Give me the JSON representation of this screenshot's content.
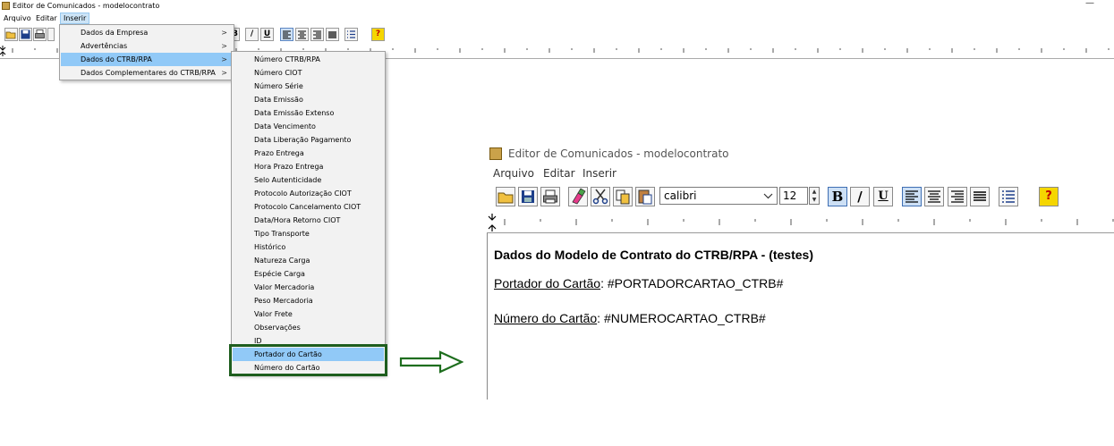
{
  "small_window": {
    "title": "Editor de Comunicados - modelocontrato",
    "minimize_glyph": "—",
    "menus": [
      "Arquivo",
      "Editar",
      "Inserir"
    ],
    "toolbar_visible_glyphs": {
      "bold": "B",
      "italic": "/",
      "underline": "U",
      "help": "?"
    }
  },
  "inserir_menu": {
    "items": [
      {
        "label": "Dados da Empresa",
        "has_submenu": true
      },
      {
        "label": "Advertências",
        "has_submenu": true
      },
      {
        "label": "Dados do CTRB/RPA",
        "has_submenu": true,
        "highlighted": true
      },
      {
        "label": "Dados Complementares do CTRB/RPA",
        "has_submenu": true
      }
    ],
    "submenu_arrow": ">"
  },
  "ctrb_submenu": {
    "items": [
      "Número CTRB/RPA",
      "Número CIOT",
      "Número Série",
      "Data Emissão",
      "Data Emissão Extenso",
      "Data Vencimento",
      "Data Liberação Pagamento",
      "Prazo Entrega",
      "Hora Prazo Entrega",
      "Selo Autenticidade",
      "Protocolo Autorização CIOT",
      "Protocolo Cancelamento CIOT",
      "Data/Hora Retorno CIOT",
      "Tipo Transporte",
      "Histórico",
      "Natureza Carga",
      "Espécie Carga",
      "Valor Mercadoria",
      "Peso Mercadoria",
      "Valor Frete",
      "Observações",
      "ID",
      "Portador do Cartão",
      "Número do Cartão"
    ],
    "highlighted_item": "Portador do Cartão"
  },
  "large_window": {
    "title": "Editor de Comunicados - modelocontrato",
    "menus": [
      "Arquivo",
      "Editar",
      "Inserir"
    ],
    "font_name": "calibri",
    "font_size": "12",
    "toolbar_glyphs": {
      "bold": "B",
      "italic": "/",
      "underline": "U",
      "help": "?"
    },
    "document": {
      "heading": "Dados do Modelo de Contrato do CTRB/RPA - (testes)",
      "lines": [
        {
          "label": "Portador do Cartão",
          "value": ": #PORTADORCARTAO_CTRB#"
        },
        {
          "label": "Número do Cartão",
          "value": ": #NUMEROCARTAO_CTRB#"
        }
      ]
    }
  },
  "colors": {
    "menu_highlight": "#91c9f7",
    "callout_border": "#1e5e1e",
    "arrow_stroke": "#1e6e1e"
  }
}
